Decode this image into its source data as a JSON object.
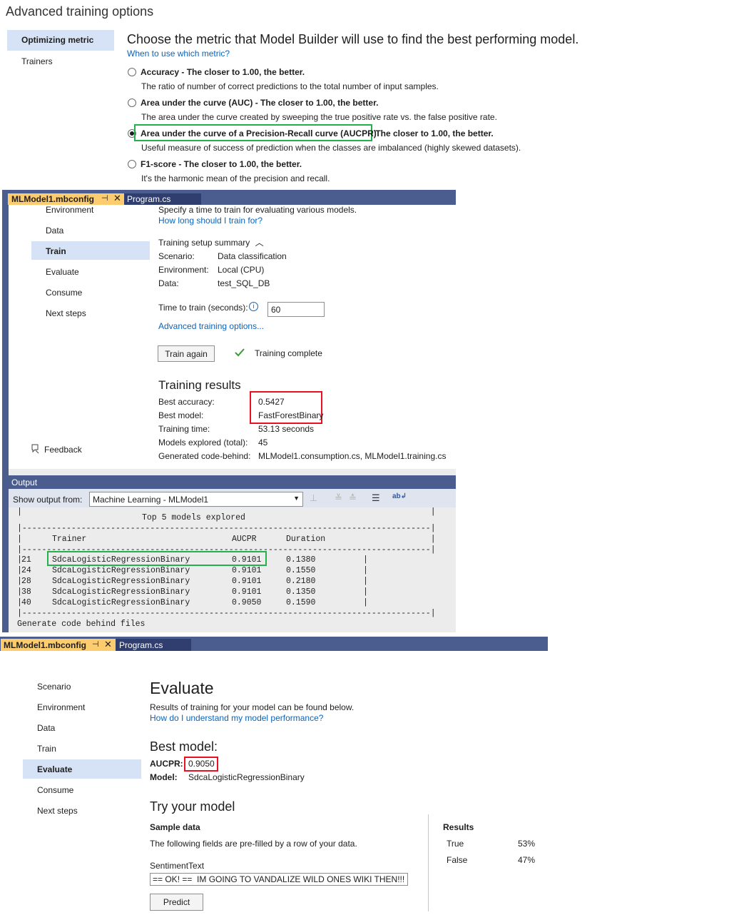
{
  "advanced": {
    "title": "Advanced training options",
    "nav": [
      "Optimizing metric",
      "Trainers"
    ],
    "heading": "Choose the metric that Model Builder will use to find the best performing model.",
    "help_link": "When to use which metric?",
    "options": [
      {
        "title": "Accuracy - The closer to 1.00, the better.",
        "desc": "The ratio of number of correct predictions to the total number of input samples.",
        "selected": false
      },
      {
        "title": "Area under the curve (AUC) - The closer to 1.00, the better.",
        "desc": "The area under the curve created by sweeping the true positive rate vs. the false positive rate.",
        "selected": false
      },
      {
        "title": "Area under the curve of a Precision-Recall curve (AUCPR)",
        "title_suffix": " - The closer to 1.00, the better.",
        "desc": "Useful measure of success of prediction when the classes are imbalanced (highly skewed datasets).",
        "selected": true
      },
      {
        "title": "F1-score - The closer to 1.00, the better.",
        "desc": "It's the harmonic mean of the precision and recall.",
        "selected": false
      }
    ]
  },
  "train_window": {
    "tabs": [
      "MLModel1.mbconfig",
      "Program.cs"
    ],
    "pin_icon": "pin-icon",
    "close_icon": "close-icon",
    "nav": [
      "Environment",
      "Data",
      "Train",
      "Evaluate",
      "Consume",
      "Next steps"
    ],
    "feedback": "Feedback",
    "intro": "Specify a time to train for evaluating various models.",
    "how_long_link": "How long should I train for?",
    "summary_header": "Training setup summary",
    "summary": [
      {
        "label": "Scenario:",
        "value": "Data classification"
      },
      {
        "label": "Environment:",
        "value": "Local (CPU)"
      },
      {
        "label": "Data:",
        "value": "test_SQL_DB"
      }
    ],
    "time_label": "Time to train (seconds):",
    "time_value": "60",
    "advanced_link": "Advanced training options...",
    "train_again": "Train again",
    "status": "Training complete",
    "results_title": "Training results",
    "results": [
      {
        "label": "Best accuracy:",
        "value": "0.5427"
      },
      {
        "label": "Best model:",
        "value": "FastForestBinary"
      },
      {
        "label": "Training time:",
        "value": "53.13 seconds"
      },
      {
        "label": "Models explored (total):",
        "value": "45"
      },
      {
        "label": "Generated code-behind:",
        "value": "MLModel1.consumption.cs, MLModel1.training.cs"
      }
    ]
  },
  "output": {
    "title": "Output",
    "show_label": "Show output from:",
    "source": "Machine Learning - MLModel1",
    "table_title": "Top 5 models explored",
    "columns": [
      "Trainer",
      "AUCPR",
      "Duration"
    ],
    "rows": [
      {
        "id": "21",
        "trainer": "SdcaLogisticRegressionBinary",
        "aucpr": "0.9101",
        "duration": "0.1380"
      },
      {
        "id": "24",
        "trainer": "SdcaLogisticRegressionBinary",
        "aucpr": "0.9101",
        "duration": "0.1550"
      },
      {
        "id": "28",
        "trainer": "SdcaLogisticRegressionBinary",
        "aucpr": "0.9101",
        "duration": "0.2180"
      },
      {
        "id": "38",
        "trainer": "SdcaLogisticRegressionBinary",
        "aucpr": "0.9101",
        "duration": "0.1350"
      },
      {
        "id": "40",
        "trainer": "SdcaLogisticRegressionBinary",
        "aucpr": "0.9050",
        "duration": "0.1590"
      }
    ],
    "footer": "Generate code behind files"
  },
  "evaluate_window": {
    "tabs": [
      "MLModel1.mbconfig",
      "Program.cs"
    ],
    "nav": [
      "Scenario",
      "Environment",
      "Data",
      "Train",
      "Evaluate",
      "Consume",
      "Next steps"
    ],
    "title": "Evaluate",
    "intro": "Results of training for your model can be found below.",
    "help_link": "How do I understand my model performance?",
    "best_model_title": "Best model:",
    "aucpr_label": "AUCPR:",
    "aucpr_value": "0.9050",
    "model_label": "Model:",
    "model_value": "SdcaLogisticRegressionBinary",
    "try_title": "Try your model",
    "sample_header": "Sample data",
    "sample_desc": "The following fields are pre-filled by a row of your data.",
    "field_label": "SentimentText",
    "field_value": "== OK! ==  IM GOING TO VANDALIZE WILD ONES WIKI THEN!!!",
    "predict": "Predict",
    "results_header": "Results",
    "results": [
      {
        "label": "True",
        "value": "53%"
      },
      {
        "label": "False",
        "value": "47%"
      }
    ]
  }
}
